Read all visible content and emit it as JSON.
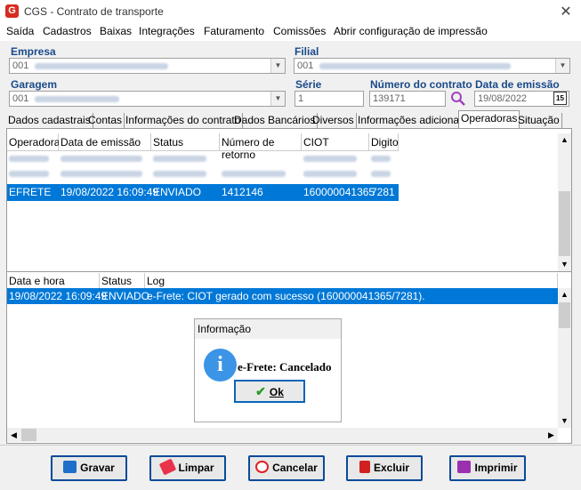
{
  "window": {
    "title": "CGS - Contrato de transporte",
    "app_icon": "cgs-logo-icon",
    "close_icon": "close-icon"
  },
  "menu": [
    "Saída",
    "Cadastros",
    "Baixas",
    "Integrações",
    "Faturamento",
    "Comissões",
    "Abrir configuração de impressão"
  ],
  "form": {
    "empresa_label": "Empresa",
    "empresa_value": "001",
    "filial_label": "Filial",
    "filial_value": "001",
    "garagem_label": "Garagem",
    "garagem_value": "001",
    "serie_label": "Série",
    "serie_value": "1",
    "numero_label": "Número do contrato",
    "numero_value": "139171",
    "data_label": "Data de emissão",
    "data_value": "19/08/2022"
  },
  "tabs": [
    "Dados cadastrais",
    "Contas",
    "Informações do contrato",
    "Dados Bancários",
    "Diversos",
    "Informações adicionais",
    "Operadoras",
    "Situação"
  ],
  "active_tab": "Operadoras",
  "operadoras_grid": {
    "columns": [
      "Operadora",
      "Data de emissão",
      "Status",
      "Número de retorno",
      "CIOT",
      "Digito"
    ],
    "selected_row": [
      "EFRETE",
      "19/08/2022 16:09:49",
      "ENVIADO",
      "1412146",
      "160000041365",
      "7281"
    ]
  },
  "log_grid": {
    "columns": [
      "Data e hora",
      "Status",
      "Log"
    ],
    "row": [
      "19/08/2022 16:09:49",
      "ENVIADO",
      "e-Frete: CIOT gerado com sucesso (160000041365/7281)."
    ]
  },
  "dialog": {
    "title": "Informação",
    "message": "e-Frete:  Cancelado",
    "ok_label": "Ok"
  },
  "buttons": {
    "gravar": "Gravar",
    "limpar": "Limpar",
    "cancelar": "Cancelar",
    "excluir": "Excluir",
    "imprimir": "Imprimir"
  },
  "colors": {
    "accent": "#0078d7",
    "label_blue": "#1a4a8a",
    "button_border": "#0a4a9a"
  }
}
